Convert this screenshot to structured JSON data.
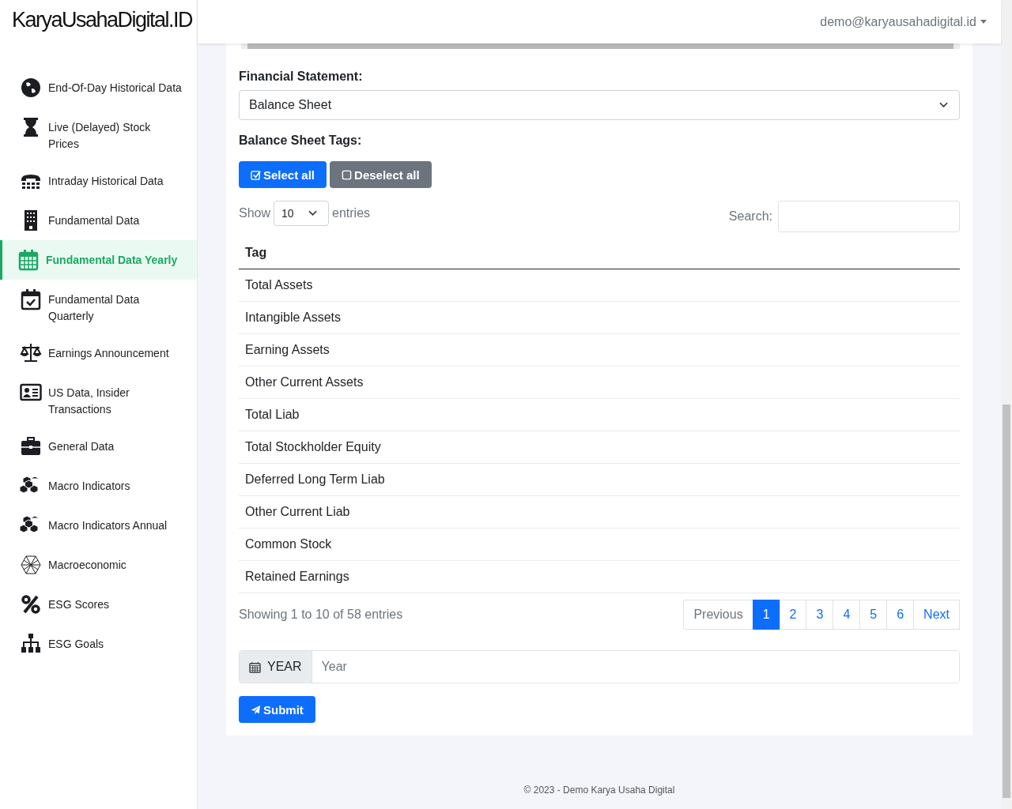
{
  "brand": "KaryaUsahaDigital.ID",
  "user_menu": {
    "label": "demo@karyausahadigital.id"
  },
  "sidebar": {
    "items": [
      {
        "label": "End-Of-Day Historical Data",
        "selected": false
      },
      {
        "label": "Live (Delayed) Stock Prices",
        "selected": false
      },
      {
        "label": "Intraday Historical Data",
        "selected": false
      },
      {
        "label": "Fundamental Data",
        "selected": false
      },
      {
        "label": "Fundamental Data Yearly",
        "selected": true
      },
      {
        "label": "Fundamental Data Quarterly",
        "selected": false
      },
      {
        "label": "Earnings Announcement",
        "selected": false
      },
      {
        "label": "US Data, Insider Transactions",
        "selected": false
      },
      {
        "label": "General Data",
        "selected": false
      },
      {
        "label": "Macro Indicators",
        "selected": false
      },
      {
        "label": "Macro Indicators Annual",
        "selected": false
      },
      {
        "label": "Macroeconomic",
        "selected": false
      },
      {
        "label": "ESG Scores",
        "selected": false
      },
      {
        "label": "ESG Goals",
        "selected": false
      }
    ]
  },
  "form": {
    "statement_label": "Financial Statement:",
    "statement_value": "Balance Sheet",
    "tags_label": "Balance Sheet Tags:",
    "select_all": "Select all",
    "deselect_all": "Deselect all",
    "show_label": "Show",
    "page_size": "10",
    "entries_label": "entries",
    "search_label": "Search:",
    "table": {
      "columns": [
        "Tag"
      ],
      "rows": [
        [
          "Total Assets"
        ],
        [
          "Intangible Assets"
        ],
        [
          "Earning Assets"
        ],
        [
          "Other Current Assets"
        ],
        [
          "Total Liab"
        ],
        [
          "Total Stockholder Equity"
        ],
        [
          "Deferred Long Term Liab"
        ],
        [
          "Other Current Liab"
        ],
        [
          "Common Stock"
        ],
        [
          "Retained Earnings"
        ]
      ]
    },
    "info": "Showing 1 to 10 of 58 entries",
    "pagination": {
      "previous": "Previous",
      "next": "Next",
      "pages": [
        {
          "label": "1",
          "selected": true
        },
        {
          "label": "2",
          "selected": false
        },
        {
          "label": "3",
          "selected": false
        },
        {
          "label": "4",
          "selected": false
        },
        {
          "label": "5",
          "selected": false
        },
        {
          "label": "6",
          "selected": false
        }
      ]
    },
    "year_label": "YEAR",
    "year_placeholder": "Year",
    "submit": "Submit"
  },
  "footer": "© 2023 - Demo Karya Usaha Digital"
}
